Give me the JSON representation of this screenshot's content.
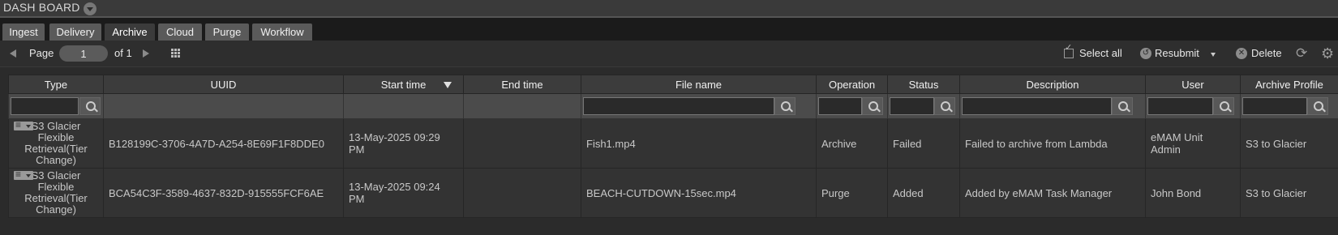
{
  "dashboard": {
    "title": "DASH BOARD"
  },
  "tabs": [
    {
      "label": "Ingest",
      "active": false
    },
    {
      "label": "Delivery",
      "active": false
    },
    {
      "label": "Archive",
      "active": true
    },
    {
      "label": "Cloud",
      "active": false
    },
    {
      "label": "Purge",
      "active": false
    },
    {
      "label": "Workflow",
      "active": false
    }
  ],
  "toolbar": {
    "page_label": "Page",
    "page_value": "1",
    "of_label": "of 1",
    "select_all": "Select all",
    "resubmit": "Resubmit",
    "delete": "Delete",
    "icons": [
      "prev-page-icon",
      "next-page-icon",
      "grid-view-icon",
      "checkbox-icon",
      "resubmit-icon",
      "delete-icon",
      "refresh-icon",
      "settings-icon"
    ]
  },
  "table": {
    "columns": [
      "Type",
      "UUID",
      "Start time",
      "End time",
      "File name",
      "Operation",
      "Status",
      "Description",
      "User",
      "Archive Profile"
    ],
    "sort_column": "Start time",
    "rows": [
      {
        "type": "S3 Glacier Flexible Retrieval(Tier Change)",
        "uuid": "B128199C-3706-4A7D-A254-8E69F1F8DDE0",
        "start_time": "13-May-2025 09:29 PM",
        "end_time": "",
        "file_name": "Fish1.mp4",
        "operation": "Archive",
        "status": "Failed",
        "description": "Failed to archive from Lambda",
        "user": "eMAM Unit Admin",
        "archive_profile": "S3 to Glacier"
      },
      {
        "type": "S3 Glacier Flexible Retrieval(Tier Change)",
        "uuid": "BCA54C3F-3589-4637-832D-915555FCF6AE",
        "start_time": "13-May-2025 09:24 PM",
        "end_time": "",
        "file_name": "BEACH-CUTDOWN-15sec.mp4",
        "operation": "Purge",
        "status": "Added",
        "description": "Added by eMAM Task Manager",
        "user": "John Bond",
        "archive_profile": "S3 to Glacier"
      }
    ]
  }
}
